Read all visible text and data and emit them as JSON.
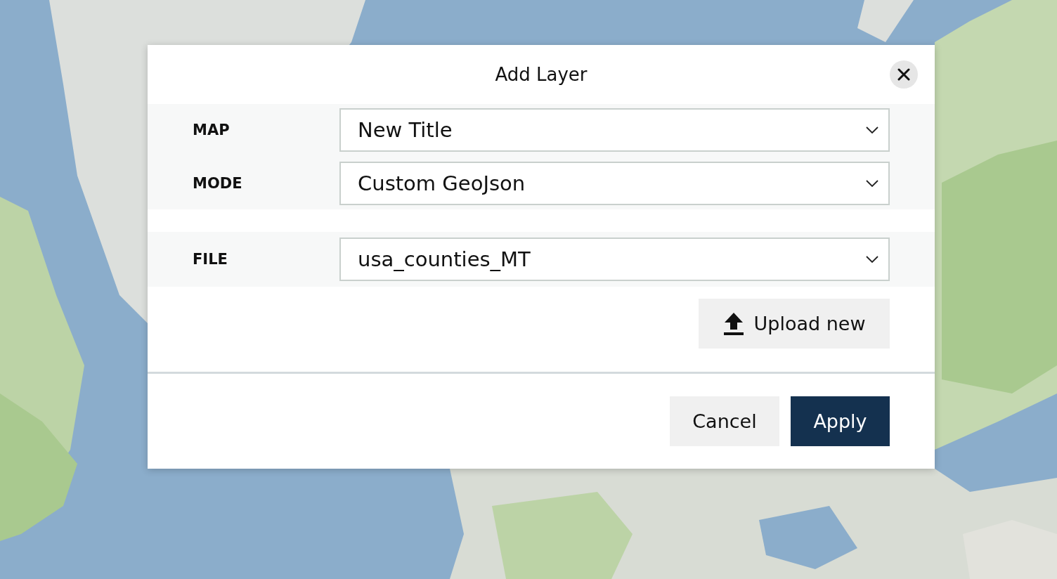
{
  "dialog": {
    "title": "Add Layer",
    "field_groups": [
      {
        "fields": [
          {
            "label": "MAP",
            "value": "New Title"
          },
          {
            "label": "MODE",
            "value": "Custom GeoJson"
          }
        ]
      },
      {
        "fields": [
          {
            "label": "FILE",
            "value": "usa_counties_MT"
          }
        ]
      }
    ],
    "upload_button": {
      "label": "Upload new"
    },
    "buttons": [
      {
        "label": "Cancel",
        "kind": "secondary"
      },
      {
        "label": "Apply",
        "kind": "primary"
      }
    ]
  }
}
